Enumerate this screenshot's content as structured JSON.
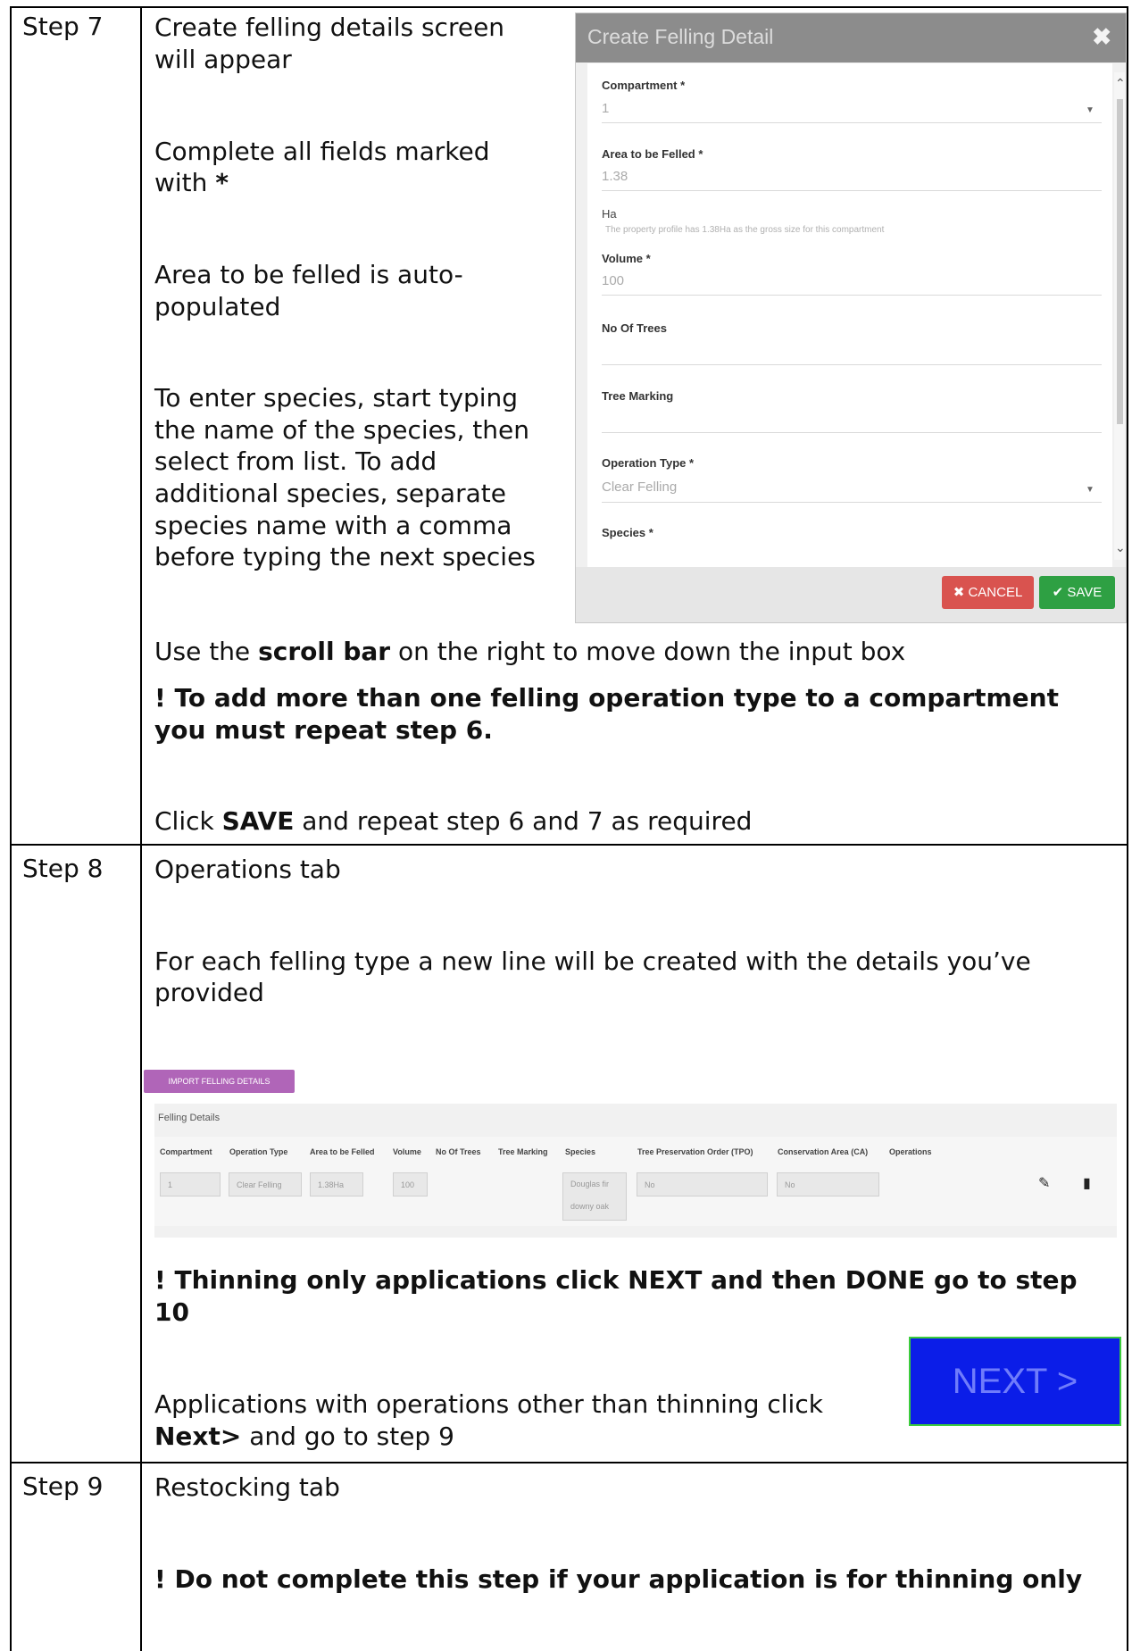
{
  "steps": {
    "step7": {
      "label": "Step 7",
      "line1a": "Create felling details screen",
      "line1b": "will appear",
      "line2a": "Complete all fields marked",
      "line2b_prefix": "with ",
      "line2b_star": "*",
      "line3a": "Area to be felled is auto-",
      "line3b": "populated",
      "species_lines": [
        "To enter species, start typing",
        "the name of the species, then",
        "select from list. To add",
        "additional species, separate",
        "species name with a comma",
        "before typing the next species"
      ],
      "scroll_prefix": "Use the ",
      "scroll_bold": "scroll bar",
      "scroll_suffix": " on the right to move down the input box",
      "warn_line1": "! To add more than one felling operation type to a compartment",
      "warn_line2": "you must repeat step 6.",
      "click_prefix": "Click ",
      "click_bold": "SAVE",
      "click_suffix": " and repeat step 6 and 7 as required"
    },
    "step8": {
      "label": "Step 8",
      "heading": "Operations tab",
      "desc_line1": "For each felling type a new line will be created with the details you’ve",
      "desc_line2": "provided",
      "warn_line1": "! Thinning only applications click NEXT and then DONE go to step",
      "warn_line2": "10",
      "apps_line1": "Applications with operations other than thinning click",
      "apps_bold": "Next>",
      "apps_suffix": " and go to step 9"
    },
    "step9": {
      "label": "Step 9",
      "heading": "Restocking tab",
      "warn": "! Do not complete this step if your application is for thinning only"
    }
  },
  "modal": {
    "title": "Create Felling Detail",
    "close": "✖",
    "compartment_label": "Compartment *",
    "compartment_value": "1",
    "area_label": "Area to be Felled *",
    "area_value": "1.38",
    "area_unit": "Ha",
    "area_help": "The property profile has 1.38Ha as the gross size for this compartment",
    "volume_label": "Volume *",
    "volume_value": "100",
    "trees_label": "No Of Trees",
    "marking_label": "Tree Marking",
    "optype_label": "Operation Type *",
    "optype_value": "Clear Felling",
    "species_label": "Species *",
    "cancel_label": "✖ CANCEL",
    "save_label": "✔ SAVE"
  },
  "felling_table": {
    "import_label": "IMPORT FELLING DETAILS",
    "panel_title": "Felling Details",
    "headers": [
      "Compartment",
      "Operation Type",
      "Area to be Felled",
      "Volume",
      "No Of Trees",
      "Tree Marking",
      "Species",
      "Tree Preservation Order (TPO)",
      "Conservation Area (CA)",
      "Operations"
    ],
    "row": {
      "compartment": "1",
      "operation_type": "Clear Felling",
      "area": "1.38Ha",
      "volume": "100",
      "species_line1": "Douglas fir",
      "species_line2": "downy oak",
      "tpo": "No",
      "ca": "No"
    }
  },
  "next_button": "NEXT >"
}
